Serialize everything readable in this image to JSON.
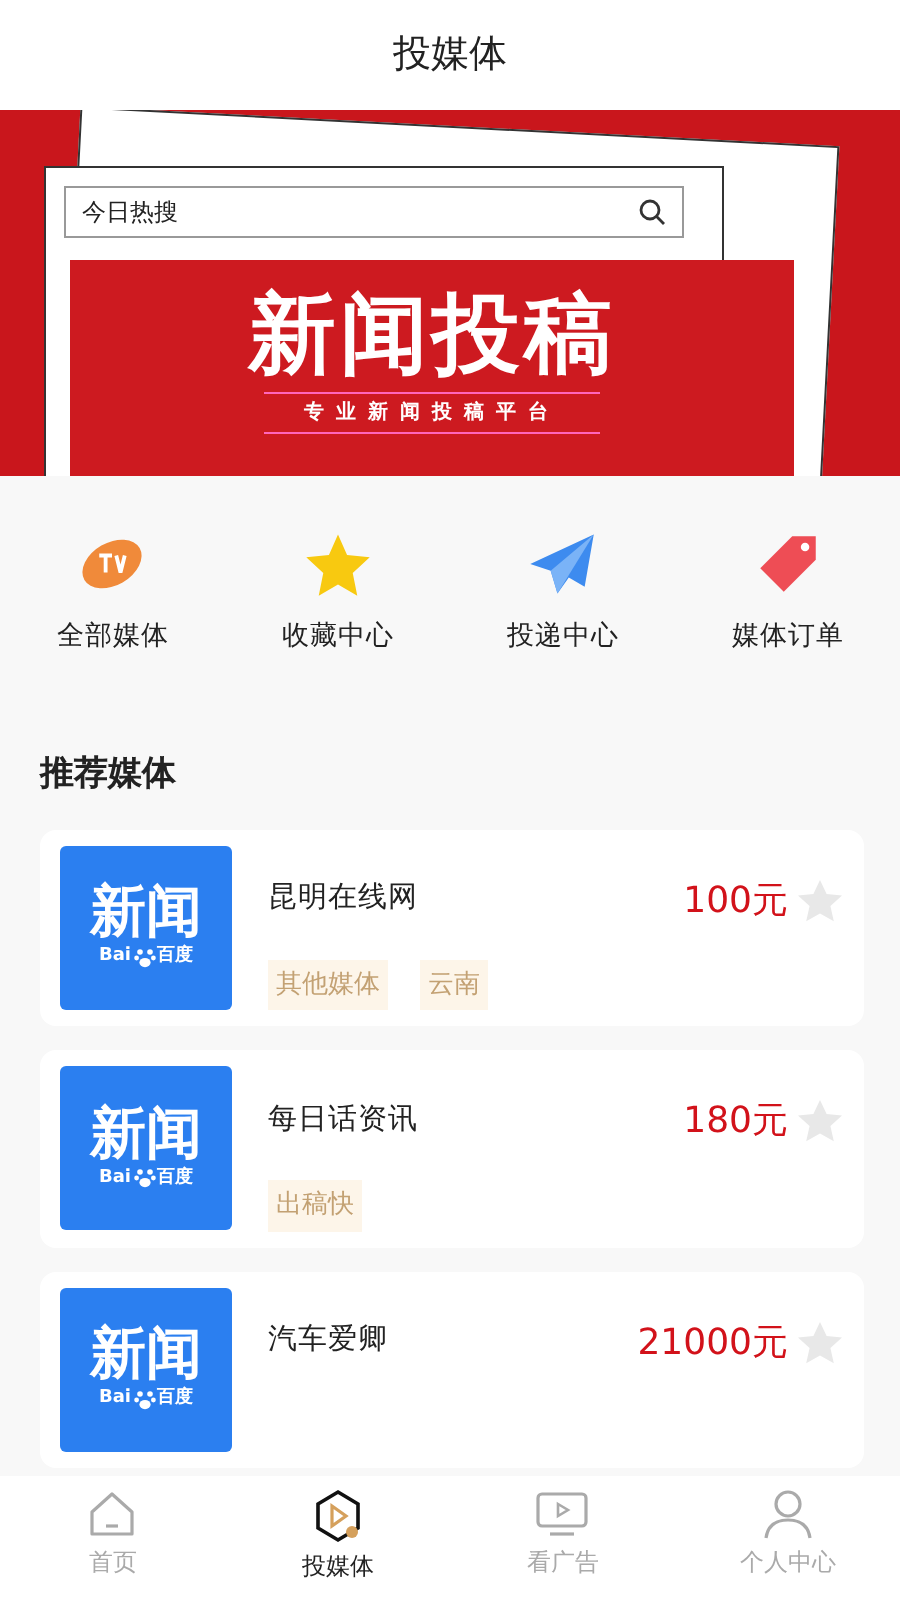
{
  "header": {
    "title": "投媒体"
  },
  "banner": {
    "search_placeholder": "今日热搜",
    "headline": "新闻投稿",
    "subtitle": "专业新闻投稿平台"
  },
  "shortcuts": [
    {
      "kind": "tv",
      "label": "全部媒体"
    },
    {
      "kind": "star",
      "label": "收藏中心"
    },
    {
      "kind": "plane",
      "label": "投递中心"
    },
    {
      "kind": "tag",
      "label": "媒体订单"
    }
  ],
  "section_title": "推荐媒体",
  "media": [
    {
      "logo_title": "新闻",
      "logo_brand_left": "Bai",
      "logo_brand_right": "百度",
      "name": "昆明在线网",
      "price": "100元",
      "favorited": false,
      "tags": [
        "其他媒体",
        "云南"
      ]
    },
    {
      "logo_title": "新闻",
      "logo_brand_left": "Bai",
      "logo_brand_right": "百度",
      "name": "每日话资讯",
      "price": "180元",
      "favorited": false,
      "tags": [
        "出稿快"
      ]
    },
    {
      "logo_title": "新闻",
      "logo_brand_left": "Bai",
      "logo_brand_right": "百度",
      "name": "汽车爱卿",
      "price": "21000元",
      "favorited": false
    }
  ],
  "tab_bar": [
    {
      "kind": "home",
      "label": "首页",
      "selected": false
    },
    {
      "kind": "play",
      "label": "投媒体",
      "selected": true
    },
    {
      "kind": "screen",
      "label": "看广告",
      "selected": false
    },
    {
      "kind": "person",
      "label": "个人中心",
      "selected": false
    }
  ]
}
